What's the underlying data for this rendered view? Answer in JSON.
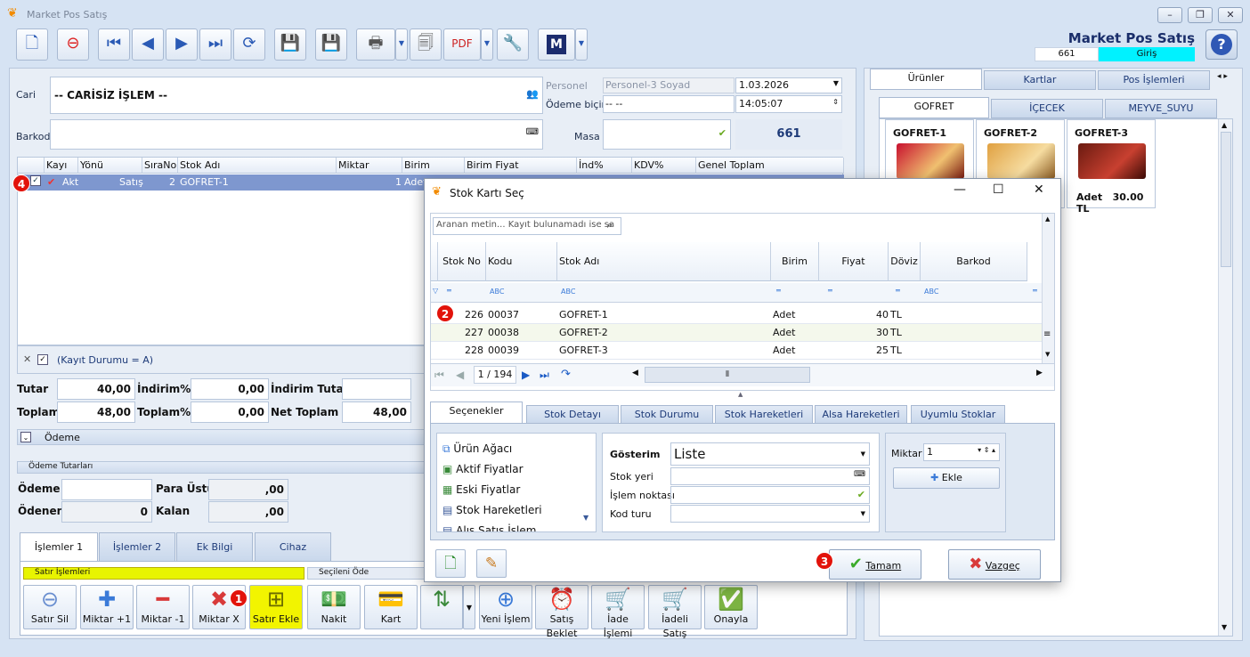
{
  "app": {
    "title": "Market Pos Satış",
    "brand": "Market Pos Satış",
    "status_code": "661",
    "status_text": "Giriş"
  },
  "form": {
    "cari_label": "Cari",
    "cari_value": "-- CARİSİZ İŞLEM --",
    "barkod_label": "Barkod",
    "personel_label": "Personel",
    "personel_value": "Personel-3 Soyad",
    "odeme_label": "Ödeme biçimi",
    "odeme_value": "-- --",
    "date": "1.03.2026",
    "time": "14:05:07",
    "masa_label": "Masa",
    "masa_code": "661"
  },
  "grid": {
    "headers": [
      "Kayı",
      "Yönü",
      "SıraNo",
      "Stok Adı",
      "Miktar",
      "Birim",
      "Birim Fiyat",
      "İnd%",
      "KDV%",
      "Genel Toplam"
    ],
    "row": {
      "kayit": "Akt",
      "yonu": "Satış",
      "sira": "2",
      "stok": "GOFRET-1",
      "miktar": "1",
      "birim": "Adet"
    },
    "filter": "(Kayıt Durumu = A)"
  },
  "totals": {
    "tutar_label": "Tutar",
    "tutar": "40,00",
    "indirim_label": "İndirim%",
    "indirim": "0,00",
    "indirim_tutar_label": "İndirim Tutar",
    "toplam_label": "Toplam",
    "toplam": "48,00",
    "toplam_pct_label": "Toplam%",
    "toplam_pct": "0,00",
    "net_label": "Net Toplam",
    "net": "48,00"
  },
  "odeme_section": {
    "title": "Ödeme",
    "tutarlar": "Ödeme Tutarları",
    "odeme": "Ödeme",
    "para_ustu": "Para Üstü",
    "para_ustu_val": ",00",
    "odenen": "Ödenen",
    "odenen_val": "0",
    "kalan": "Kalan",
    "kalan_val": ",00"
  },
  "bottom_tabs": [
    "İşlemler 1",
    "İşlemler 2",
    "Ek Bilgi",
    "Cihaz"
  ],
  "satir_islemleri": {
    "title": "Satır İşlemleri",
    "buttons": [
      "Satır Sil",
      "Miktar +1",
      "Miktar -1",
      "Miktar X",
      "Satır Ekle"
    ]
  },
  "secileni_ode": {
    "title": "Seçileni Öde",
    "buttons": [
      "Nakit",
      "Kart"
    ]
  },
  "actions": [
    "Yeni İşlem",
    "Satış Beklet",
    "İade İşlemi",
    "İadeli Satış",
    "Onayla"
  ],
  "badges": [
    "1",
    "2",
    "3",
    "4"
  ],
  "right": {
    "tabs": [
      "Ürünler",
      "Kartlar",
      "Pos İşlemleri"
    ],
    "cat_tabs": [
      "GOFRET",
      "İÇECEK",
      "MEYVE_SUYU"
    ],
    "products": [
      {
        "name": "GOFRET-1"
      },
      {
        "name": "GOFRET-2"
      },
      {
        "name": "GOFRET-3",
        "unit": "Adet",
        "price": "30.00 TL"
      }
    ]
  },
  "dialog": {
    "title": "Stok Kartı Seç",
    "search_placeholder": "Aranan metin... Kayıt bulunamadı ise sa",
    "headers": [
      "Stok No",
      "Kodu",
      "Stok Adı",
      "Birim",
      "Fiyat",
      "Döviz",
      "Barkod"
    ],
    "rows": [
      {
        "no": "226",
        "kod": "00037",
        "ad": "GOFRET-1",
        "birim": "Adet",
        "fiyat": "40",
        "doviz": "TL"
      },
      {
        "no": "227",
        "kod": "00038",
        "ad": "GOFRET-2",
        "birim": "Adet",
        "fiyat": "30",
        "doviz": "TL"
      },
      {
        "no": "228",
        "kod": "00039",
        "ad": "GOFRET-3",
        "birim": "Adet",
        "fiyat": "25",
        "doviz": "TL"
      }
    ],
    "pager": "1 / 194",
    "tabs": [
      "Seçenekler",
      "Stok Detayı",
      "Stok Durumu",
      "Stok Hareketleri",
      "Alsa Hareketleri",
      "Uyumlu Stoklar"
    ],
    "options": [
      "Ürün Ağacı",
      "Aktif Fiyatlar",
      "Eski Fiyatlar",
      "Stok Hareketleri",
      "Alış Satış İşlem Hareketleri"
    ],
    "gosterim_label": "Gösterim",
    "gosterim_value": "Liste",
    "stok_yeri": "Stok yeri",
    "islem_noktasi": "İşlem noktası",
    "kod_turu": "Kod turu",
    "miktar_label": "Miktar",
    "miktar_value": "1",
    "ekle": "Ekle",
    "tamam": "Tamam",
    "vazgec": "Vazgeç"
  }
}
